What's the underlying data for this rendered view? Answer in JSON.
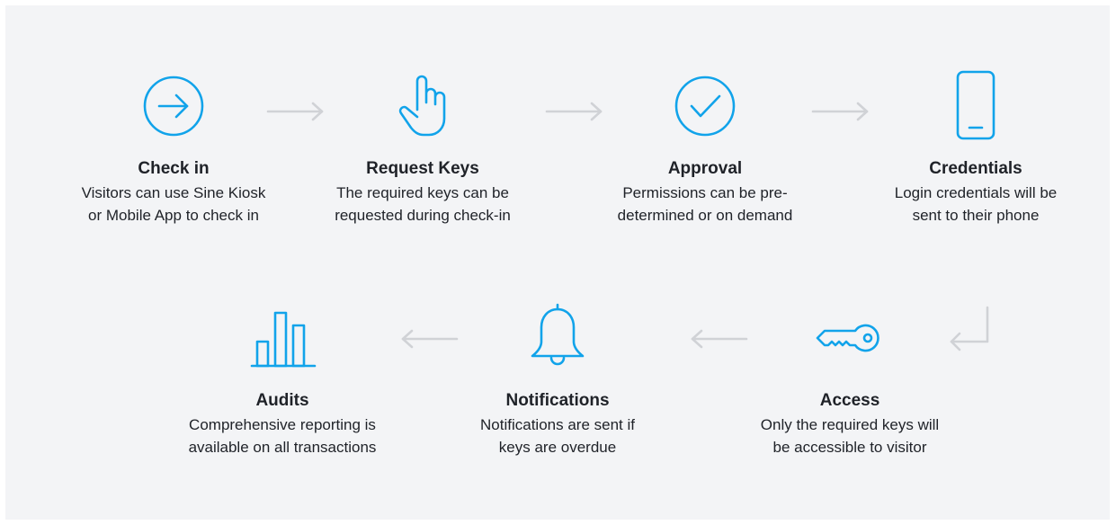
{
  "colors": {
    "accent": "#11a3ea",
    "arrow": "#d0d2d6",
    "background": "#f3f4f6",
    "text": "#1f2228"
  },
  "steps": [
    {
      "icon": "arrow-circle-right-icon",
      "title": "Check in",
      "description": "Visitors can use Sine Kiosk\nor Mobile App to check in"
    },
    {
      "icon": "hand-pointer-icon",
      "title": "Request Keys",
      "description": "The required keys can be\nrequested during check-in"
    },
    {
      "icon": "check-circle-icon",
      "title": "Approval",
      "description": "Permissions can be pre-\ndetermined or on demand"
    },
    {
      "icon": "smartphone-icon",
      "title": "Credentials",
      "description": "Login credentials will be\nsent to their phone"
    },
    {
      "icon": "key-icon",
      "title": "Access",
      "description": "Only the required keys will\nbe accessible to visitor"
    },
    {
      "icon": "bell-icon",
      "title": "Notifications",
      "description": "Notifications are sent if\nkeys are overdue"
    },
    {
      "icon": "bar-chart-icon",
      "title": "Audits",
      "description": "Comprehensive reporting is\navailable on all transactions"
    }
  ],
  "connectors": [
    {
      "icon": "arrow-right-icon"
    },
    {
      "icon": "arrow-right-icon"
    },
    {
      "icon": "arrow-right-icon"
    },
    {
      "icon": "return-arrow-icon"
    },
    {
      "icon": "arrow-left-icon"
    },
    {
      "icon": "arrow-left-icon"
    }
  ]
}
